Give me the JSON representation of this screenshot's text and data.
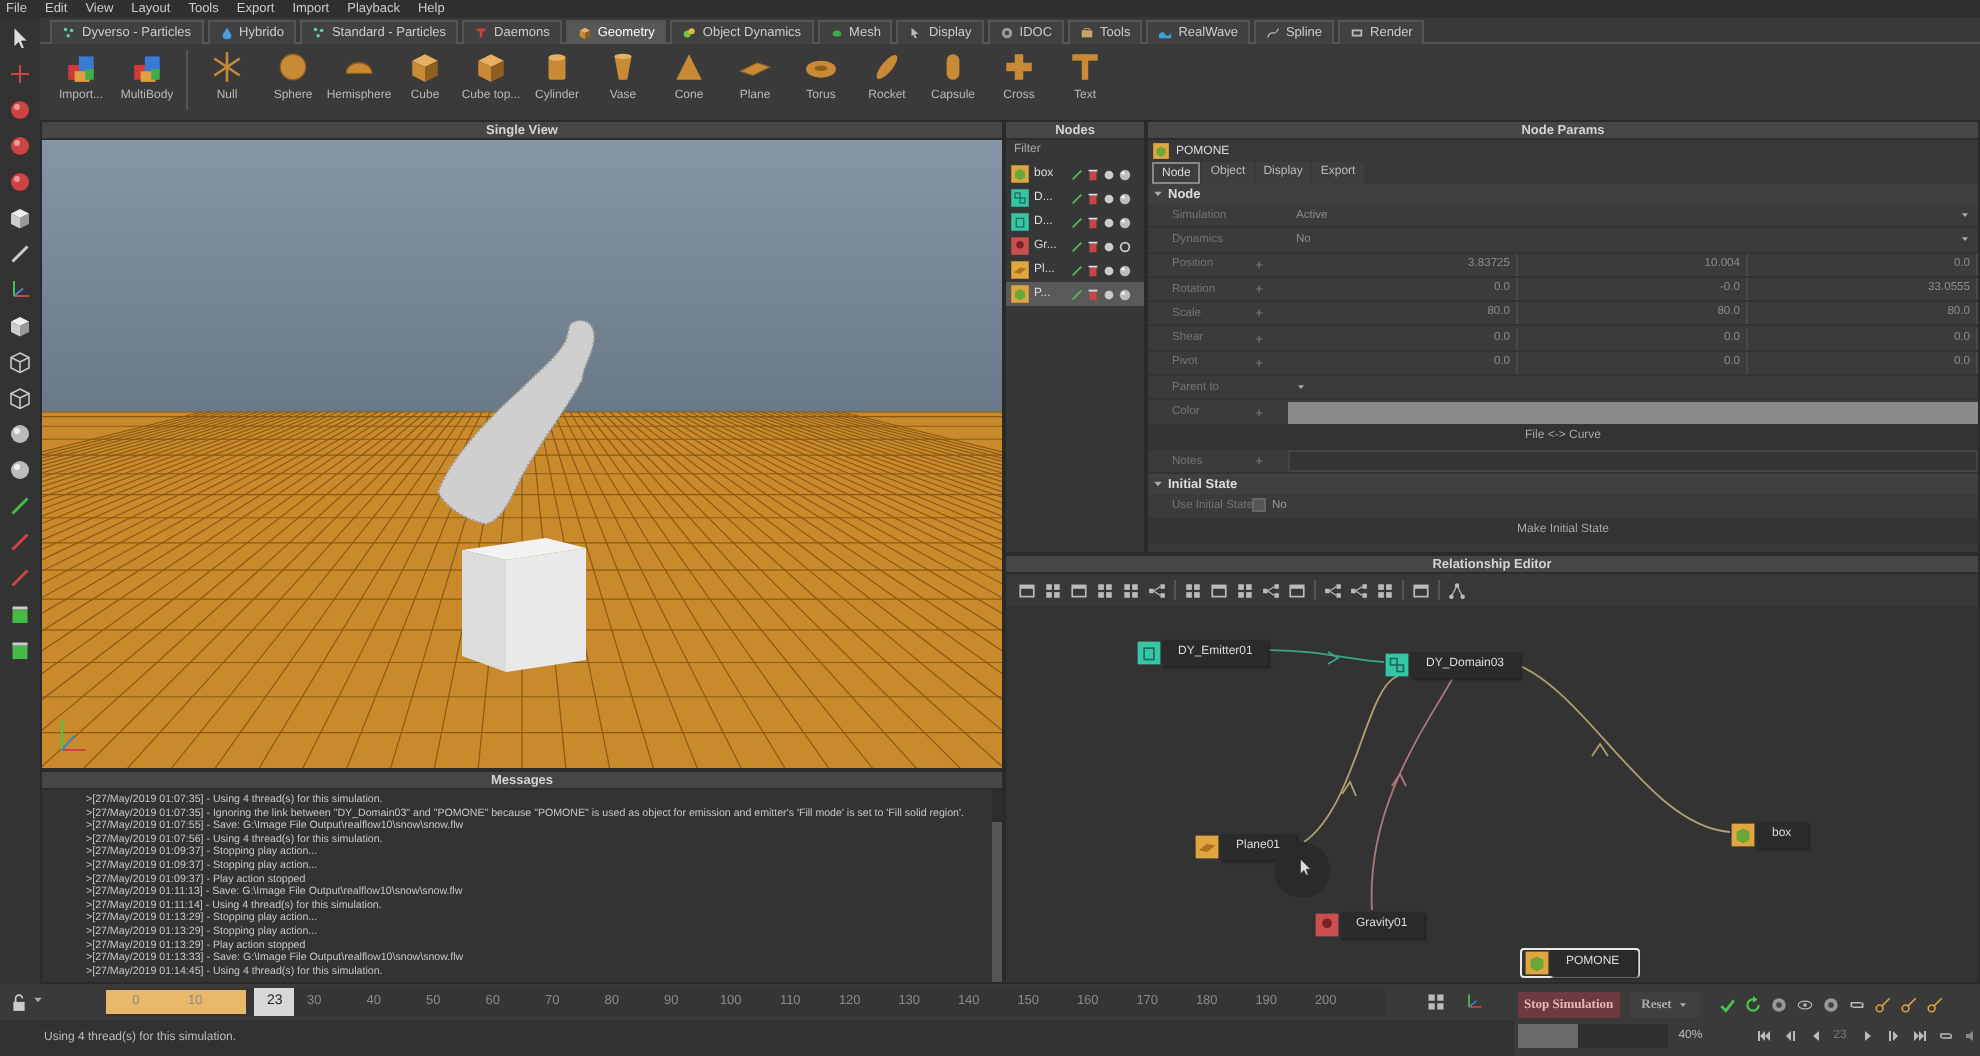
{
  "menu": [
    "File",
    "Edit",
    "View",
    "Layout",
    "Tools",
    "Export",
    "Import",
    "Playback",
    "Help"
  ],
  "shelf": {
    "tabs": [
      {
        "label": "Dyverso - Particles",
        "selected": false
      },
      {
        "label": "Hybrido",
        "selected": false
      },
      {
        "label": "Standard - Particles",
        "selected": false
      },
      {
        "label": "Daemons",
        "selected": false
      },
      {
        "label": "Geometry",
        "selected": true
      },
      {
        "label": "Object Dynamics",
        "selected": false
      },
      {
        "label": "Mesh",
        "selected": false
      },
      {
        "label": "Display",
        "selected": false
      },
      {
        "label": "IDOC",
        "selected": false
      },
      {
        "label": "Tools",
        "selected": false
      },
      {
        "label": "RealWave",
        "selected": false
      },
      {
        "label": "Spline",
        "selected": false
      },
      {
        "label": "Render",
        "selected": false
      }
    ],
    "tools": [
      {
        "label": "Import...",
        "kind": "import"
      },
      {
        "label": "MultiBody",
        "kind": "multibody"
      },
      {
        "label": "Null",
        "kind": "null"
      },
      {
        "label": "Sphere",
        "kind": "sphere"
      },
      {
        "label": "Hemisphere",
        "kind": "hemisphere"
      },
      {
        "label": "Cube",
        "kind": "cube"
      },
      {
        "label": "Cube top...",
        "kind": "cube"
      },
      {
        "label": "Cylinder",
        "kind": "cylinder"
      },
      {
        "label": "Vase",
        "kind": "vase"
      },
      {
        "label": "Cone",
        "kind": "cone"
      },
      {
        "label": "Plane",
        "kind": "plane"
      },
      {
        "label": "Torus",
        "kind": "torus"
      },
      {
        "label": "Rocket",
        "kind": "rocket"
      },
      {
        "label": "Capsule",
        "kind": "capsule"
      },
      {
        "label": "Cross",
        "kind": "cross"
      },
      {
        "label": "Text",
        "kind": "text"
      }
    ]
  },
  "viewport": {
    "title": "Single View"
  },
  "messages": {
    "title": "Messages",
    "lines": [
      ">[27/May/2019 01:07:35] - Using 4 thread(s) for this simulation.",
      ">[27/May/2019 01:07:35] - Ignoring the link between \"DY_Domain03\" and \"POMONE\" because \"POMONE\" is used as object for emission and emitter's 'Fill mode' is set to 'Fill solid region'.",
      ">[27/May/2019 01:07:55] - Save: G:\\Image File Output\\realflow10\\snow\\snow.flw",
      ">[27/May/2019 01:07:56] - Using 4 thread(s) for this simulation.",
      ">[27/May/2019 01:09:37] - Stopping play action...",
      ">[27/May/2019 01:09:37] - Stopping play action...",
      ">[27/May/2019 01:09:37] - Play action stopped",
      ">[27/May/2019 01:11:13] - Save: G:\\Image File Output\\realflow10\\snow\\snow.flw",
      ">[27/May/2019 01:11:14] - Using 4 thread(s) for this simulation.",
      ">[27/May/2019 01:13:29] - Stopping play action...",
      ">[27/May/2019 01:13:29] - Stopping play action...",
      ">[27/May/2019 01:13:29] - Play action stopped",
      ">[27/May/2019 01:13:33] - Save: G:\\Image File Output\\realflow10\\snow\\snow.flw",
      ">[27/May/2019 01:14:45] - Using 4 thread(s) for this simulation."
    ]
  },
  "nodes": {
    "title": "Nodes",
    "filter": "Filter",
    "items": [
      {
        "name": "box",
        "kind": "object",
        "selected": false
      },
      {
        "name": "D...",
        "kind": "domain",
        "selected": false
      },
      {
        "name": "D...",
        "kind": "emitter",
        "selected": false
      },
      {
        "name": "Gr...",
        "kind": "daemon",
        "selected": false
      },
      {
        "name": "Pl...",
        "kind": "plane",
        "selected": false
      },
      {
        "name": "P...",
        "kind": "object",
        "selected": true
      }
    ]
  },
  "node_params": {
    "title": "Node Params",
    "object": "POMONE",
    "tabs": [
      {
        "label": "Node",
        "selected": true
      },
      {
        "label": "Object",
        "selected": false
      },
      {
        "label": "Display",
        "selected": false
      },
      {
        "label": "Export",
        "selected": false
      }
    ],
    "sections": [
      {
        "title": "Node",
        "expanded": true,
        "rows": [
          {
            "kind": "dropdown",
            "label": "Simulation",
            "value": "Active"
          },
          {
            "kind": "dropdown",
            "label": "Dynamics",
            "value": "No"
          },
          {
            "kind": "vector",
            "label": "Position",
            "values": [
              "3.83725",
              "10.004",
              "0.0"
            ]
          },
          {
            "kind": "vector",
            "label": "Rotation",
            "values": [
              "0.0",
              "-0.0",
              "33.0555"
            ]
          },
          {
            "kind": "vector",
            "label": "Scale",
            "values": [
              "80.0",
              "80.0",
              "80.0"
            ]
          },
          {
            "kind": "vector",
            "label": "Shear",
            "values": [
              "0.0",
              "0.0",
              "0.0"
            ]
          },
          {
            "kind": "vector",
            "label": "Pivot",
            "values": [
              "0.0",
              "0.0",
              "0.0"
            ]
          },
          {
            "kind": "dropdown",
            "label": "Parent to"
          },
          {
            "kind": "color",
            "label": "Color"
          },
          {
            "kind": "button",
            "label": "File <-> Curve"
          },
          {
            "kind": "text",
            "label": "Notes"
          }
        ]
      },
      {
        "title": "Initial State",
        "expanded": true,
        "rows": [
          {
            "kind": "checkbox",
            "label": "Use Initial State",
            "checked": false,
            "value": "No"
          },
          {
            "kind": "button",
            "label": "Make Initial State"
          }
        ]
      }
    ]
  },
  "relationship_editor": {
    "title": "Relationship Editor",
    "nodes": [
      {
        "name": "DY_Emitter01",
        "kind": "emitter",
        "selected": false
      },
      {
        "name": "DY_Domain03",
        "kind": "domain",
        "selected": false
      },
      {
        "name": "Plane01",
        "kind": "plane",
        "selected": false
      },
      {
        "name": "Gravity01",
        "kind": "daemon",
        "selected": false
      },
      {
        "name": "box",
        "kind": "object",
        "selected": false
      },
      {
        "name": "POMONE",
        "kind": "object",
        "selected": true
      }
    ]
  },
  "timeline": {
    "ticks": [
      "0",
      "10",
      "30",
      "40",
      "50",
      "60",
      "70",
      "80",
      "90",
      "100",
      "110",
      "120",
      "130",
      "140",
      "150",
      "160",
      "170",
      "180",
      "190",
      "200"
    ],
    "current_frame": "23",
    "level": 0.11
  },
  "simulation": {
    "stop_button": "Stop Simulation",
    "reset_button": "Reset",
    "progress": {
      "level": 0.4,
      "reading": "40%"
    },
    "frame": "23"
  },
  "status_bar": "Using 4 thread(s) for this simulation."
}
